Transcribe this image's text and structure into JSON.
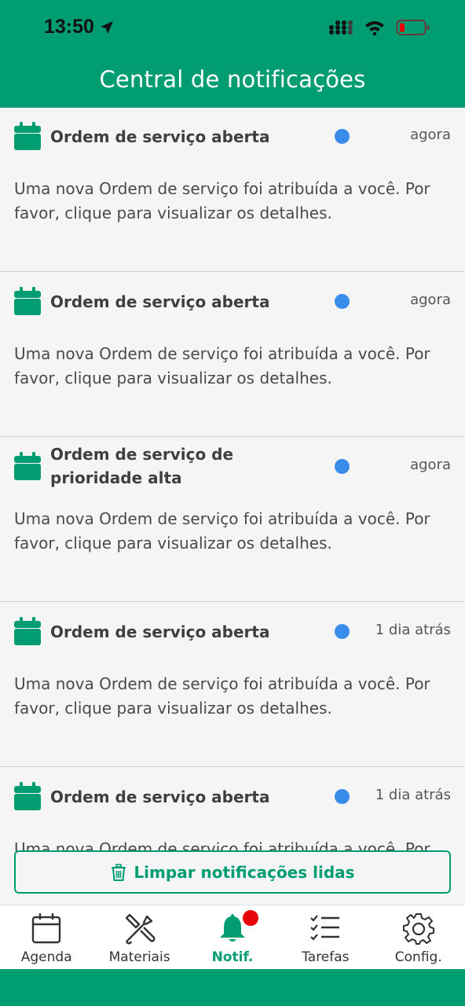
{
  "status_bar": {
    "time": "13:50"
  },
  "header": {
    "title": "Central de notificações"
  },
  "notifications": [
    {
      "title": "Ordem de serviço aberta",
      "time": "agora",
      "body": "Uma nova Ordem de serviço foi atribuída a você. Por favor, clique para visualizar os detalhes.",
      "icon": "calendar-icon",
      "unread": true
    },
    {
      "title": "Ordem de serviço aberta",
      "time": "agora",
      "body": "Uma nova Ordem de serviço foi atribuída a você. Por favor, clique para visualizar os detalhes.",
      "icon": "calendar-icon",
      "unread": true
    },
    {
      "title": "Ordem de serviço de prioridade alta",
      "time": "agora",
      "body": "Uma nova Ordem de serviço foi atribuída a você. Por favor, clique para visualizar os detalhes.",
      "icon": "calendar-icon",
      "unread": true
    },
    {
      "title": "Ordem de serviço aberta",
      "time": "1 dia atrás",
      "body": "Uma nova Ordem de serviço foi atribuída a você. Por favor, clique para visualizar os detalhes.",
      "icon": "calendar-icon",
      "unread": true
    },
    {
      "title": "Ordem de serviço aberta",
      "time": "1 dia atrás",
      "body": "Uma nova Ordem de serviço foi atribuída a você. Por favor, clique para visualizar os detalhes.",
      "icon": "calendar-icon",
      "unread": true
    }
  ],
  "clear_button": {
    "label": "Limpar notificações lidas",
    "icon": "trash-icon"
  },
  "tabbar": {
    "items": [
      {
        "label": "Agenda",
        "icon": "calendar-icon"
      },
      {
        "label": "Materiais",
        "icon": "tools-icon"
      },
      {
        "label": "Notif.",
        "icon": "bell-icon",
        "active": true,
        "has_badge": true
      },
      {
        "label": "Tarefas",
        "icon": "checklist-icon"
      },
      {
        "label": "Config.",
        "icon": "gear-icon"
      }
    ]
  },
  "colors": {
    "primary": "#009c72",
    "unread_dot": "#3a8ceb",
    "badge": "#e8000b",
    "background": "#f4f5f4"
  }
}
